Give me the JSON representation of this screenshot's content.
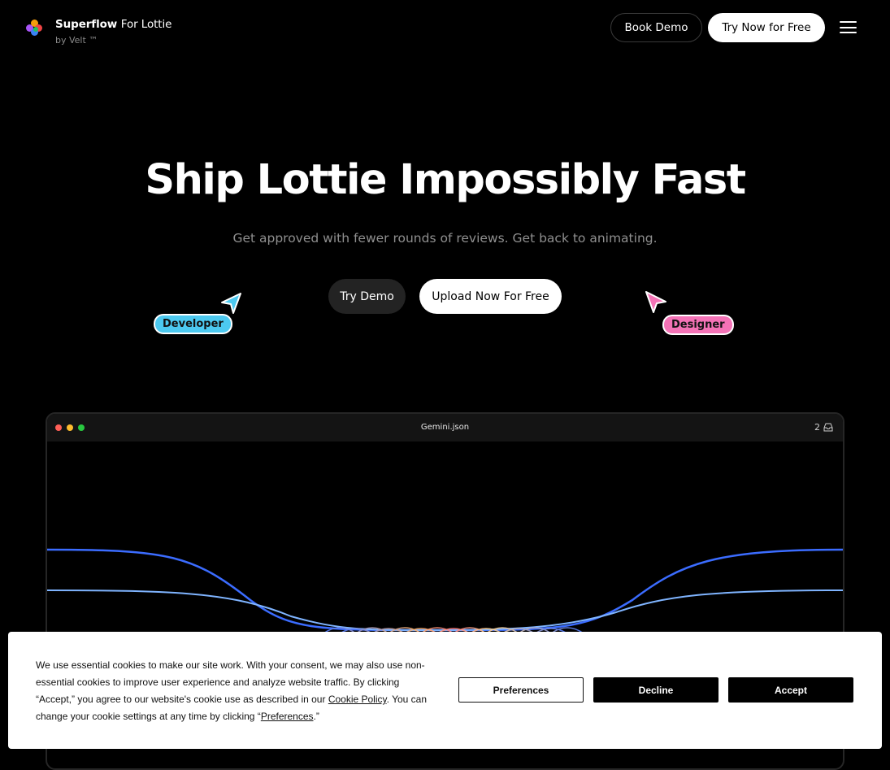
{
  "header": {
    "brand_name": "Superflow",
    "brand_suffix": "For Lottie",
    "brand_sub": "by Velt ™",
    "book_demo": "Book Demo",
    "try_free": "Try Now for Free"
  },
  "hero": {
    "title": "Ship Lottie Impossibly Fast",
    "subtitle": "Get approved with fewer rounds of reviews. Get back to animating.",
    "try_demo": "Try Demo",
    "upload": "Upload Now For Free",
    "developer_tag": "Developer",
    "designer_tag": "Designer"
  },
  "window": {
    "title": "Gemini.json",
    "comment_count": "2"
  },
  "cookie": {
    "text_1": "We use essential cookies to make our site work. With your consent, we may also use non-essential cookies to improve user experience and analyze website traffic. By clicking “Accept,” you agree to our website's cookie use as described in our ",
    "policy_link": "Cookie Policy",
    "text_2": ". You can change your cookie settings at any time by clicking “",
    "preferences_link": "Preferences",
    "text_3": ".”",
    "btn_preferences": "Preferences",
    "btn_decline": "Decline",
    "btn_accept": "Accept"
  },
  "colors": {
    "developer_accent": "#4cc9f0",
    "designer_accent": "#f472b6",
    "line_blue": "#3b6cff",
    "line_light_blue": "#7fb4ff"
  }
}
